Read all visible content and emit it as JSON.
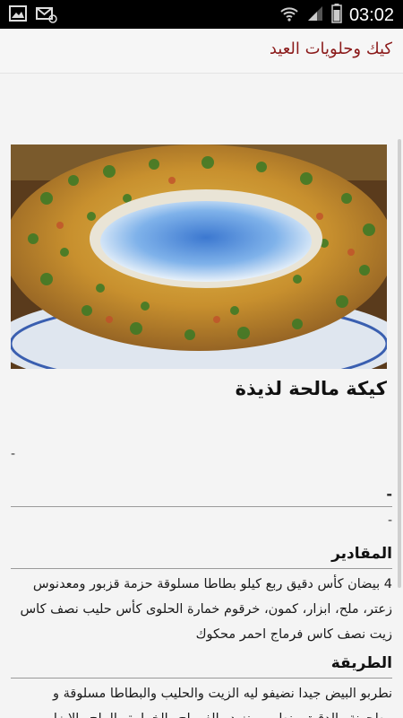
{
  "status_bar": {
    "time": "03:02",
    "icons": [
      "image-icon",
      "mail-icon",
      "wifi-icon",
      "signal-icon",
      "battery-icon"
    ]
  },
  "app_bar": {
    "title": "كيك وحلويات العيد"
  },
  "recipe": {
    "image_alt": "",
    "title": "كيكة مالحة لذيذة",
    "dash_1": "-",
    "dash_2": "-",
    "dash_3": "-",
    "ingredients_heading": "المقادير",
    "ingredients_text": "4 بيضان كأس دقيق ربع كيلو بطاطا مسلوقة حزمة قزبور ومعدنوس زعتر، ملح، ابزار، كمون، خرقوم خمارة الحلوى كأس حليب نصف كاس زيت نصف كاس فرماج احمر محكوك",
    "method_heading": "الطريقة",
    "method_text": "نطربو البيض جيدا نضيفو ليه الزيت والحليب والبطاطا مسلوقة و مطحونة والدقيق ونطربو ونزيدو الفرماج والخمارة والملح والابزار"
  },
  "colors": {
    "title_red": "#8b1a1a",
    "status_bg": "#000000",
    "page_bg": "#f4f4f4"
  }
}
